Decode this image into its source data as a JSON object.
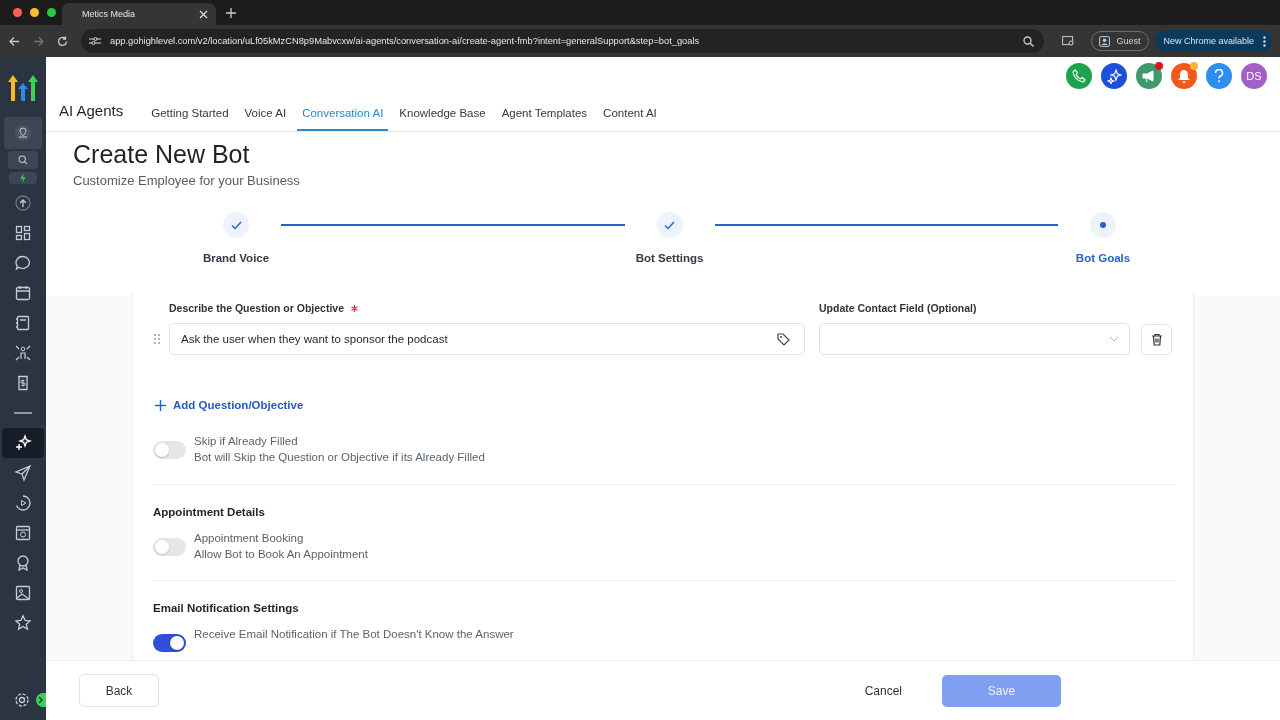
{
  "browser": {
    "tab_title": "Metics Media",
    "url": "app.gohighlevel.com/v2/location/uLf05kMzCN8p9Mabvcxw/ai-agents/conversation-ai/create-agent-fmb?intent=generalSupport&step=bot_goals",
    "profile": "Guest",
    "update_notice": "New Chrome available"
  },
  "sidebar": {
    "items": [
      {
        "kind": "location",
        "selected": false
      },
      {
        "kind": "search",
        "selected": false
      },
      {
        "kind": "bolt",
        "selected": false
      },
      {
        "kind": "upload",
        "selected": false
      },
      {
        "kind": "grid",
        "selected": false
      },
      {
        "kind": "chat",
        "selected": false
      },
      {
        "kind": "calendar",
        "selected": false
      },
      {
        "kind": "book",
        "selected": false
      },
      {
        "kind": "people",
        "selected": false
      },
      {
        "kind": "invoice",
        "selected": false
      },
      {
        "kind": "line",
        "selected": false
      },
      {
        "kind": "sparkle",
        "selected": true
      },
      {
        "kind": "send",
        "selected": false
      },
      {
        "kind": "play",
        "selected": false
      },
      {
        "kind": "site",
        "selected": false
      },
      {
        "kind": "award",
        "selected": false
      },
      {
        "kind": "image",
        "selected": false
      },
      {
        "kind": "star",
        "selected": false
      }
    ]
  },
  "header": {
    "avatar": "DS"
  },
  "app_title": "AI Agents",
  "tabs": [
    {
      "label": "Getting Started",
      "selected": false
    },
    {
      "label": "Voice AI",
      "selected": false
    },
    {
      "label": "Conversation AI",
      "selected": true
    },
    {
      "label": "Knowledge Base",
      "selected": false
    },
    {
      "label": "Agent Templates",
      "selected": false
    },
    {
      "label": "Content AI",
      "selected": false
    }
  ],
  "page": {
    "title": "Create New Bot",
    "subtitle": "Customize Employee for your Business"
  },
  "steps": [
    {
      "label": "Brand Voice",
      "done": true
    },
    {
      "label": "Bot Settings",
      "done": true
    },
    {
      "label": "Bot Goals",
      "done": false
    }
  ],
  "objective": {
    "label": "Describe the Question or Objective",
    "required": true,
    "value": "Ask the user when they want to sponsor the podcast",
    "contact_label": "Update Contact Field (Optional)",
    "add_label": "Add Question/Objective"
  },
  "skip_toggle": {
    "title": "Skip if Already Filled",
    "description": "Bot will Skip the Question or Objective if its Already Filled",
    "on": false
  },
  "sections": [
    {
      "heading": "Appointment Details",
      "toggle": {
        "title": "Appointment Booking",
        "description": "Allow Bot to Book An Appointment",
        "on": false
      }
    },
    {
      "heading": "Email Notification Settings",
      "toggle": {
        "title": "Receive Email Notification if The Bot Doesn't Know the Answer",
        "on": true
      }
    }
  ],
  "footer": {
    "back": "Back",
    "cancel": "Cancel",
    "save": "Save",
    "save_disabled": true
  }
}
